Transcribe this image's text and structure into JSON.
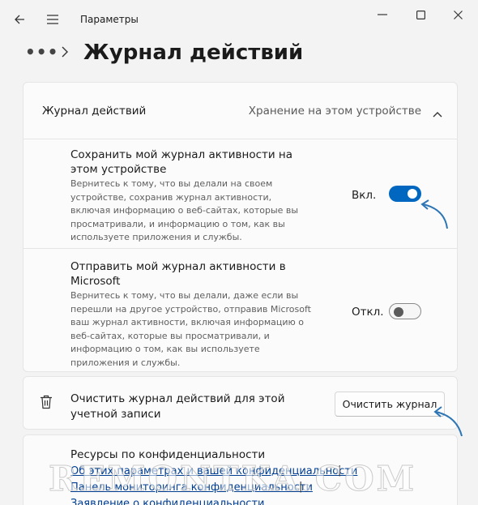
{
  "window": {
    "app_title": "Параметры"
  },
  "breadcrumb": {
    "ellipsis": "•••",
    "page_title": "Журнал действий"
  },
  "activity_section": {
    "header_label": "Журнал действий",
    "header_value": "Хранение на этом устройстве",
    "row1": {
      "title": "Сохранить мой журнал активности на этом устройстве",
      "description": "Вернитесь к тому, что вы делали на своем устройстве, сохранив журнал активности, включая информацию о веб-сайтах, которые вы просматривали, и информацию о том, как вы используете приложения и службы.",
      "toggle_label": "Вкл.",
      "toggle_on": true
    },
    "row2": {
      "title": "Отправить мой журнал активности в Microsoft",
      "description": "Вернитесь к тому, что вы делали, даже если вы перешли на другое устройство, отправив Microsoft ваш журнал активности, включая информацию о веб-сайтах, которые вы просматривали, и информацию о том, как вы используете приложения и службы.",
      "toggle_label": "Откл.",
      "toggle_on": false
    }
  },
  "clear_section": {
    "text": "Очистить журнал действий для этой учетной записи",
    "button_label": "Очистить журнал"
  },
  "resources": {
    "title": "Ресурсы по конфиденциальности",
    "links": [
      "Об этих параметрах и вашей конфиденциальности",
      "Панель мониторинга конфиденциальности",
      "Заявление о конфиденциальности"
    ],
    "separator": "|"
  },
  "watermark": "REMONTKA.COM",
  "colors": {
    "accent": "#0067c0",
    "link": "#003e92",
    "annotation_arrow": "#2e75b6"
  },
  "icons": [
    "back-arrow-icon",
    "hamburger-menu-icon",
    "minimize-icon",
    "maximize-icon",
    "close-icon",
    "chevron-right-icon",
    "chevron-up-icon",
    "trash-icon"
  ]
}
